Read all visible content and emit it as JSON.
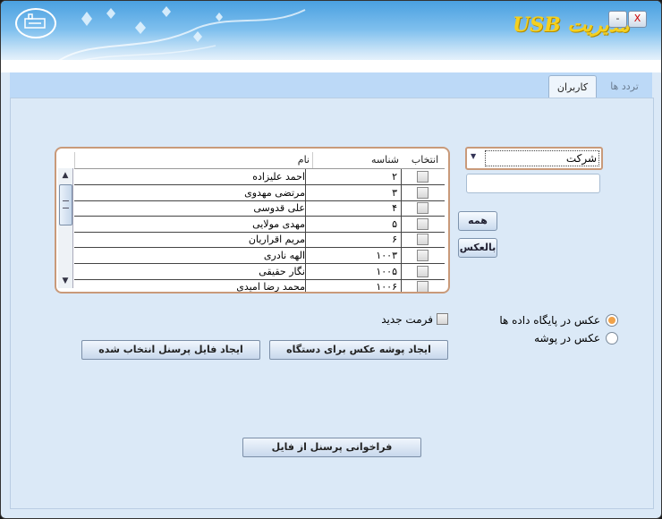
{
  "window": {
    "title": "مدیریت USB",
    "minimize_label": "-",
    "close_label": "X"
  },
  "tabs": [
    {
      "label": "کاربران",
      "active": true
    },
    {
      "label": "تردد ها",
      "active": false
    }
  ],
  "company_combo": {
    "value": "شرکت"
  },
  "search_box": {
    "value": ""
  },
  "buttons": {
    "all": "همه",
    "invert": "بالعکس",
    "create_selected_file": "ایجاد فایل پرسنل انتخاب شده",
    "create_photo_folder": "ایجاد پوشه عکس برای دستگاه",
    "import_from_file": "فراخوانی پرسنل از فایل"
  },
  "grid": {
    "headers": {
      "select": "انتخاب",
      "id": "شناسه",
      "name": "نام"
    },
    "rows": [
      {
        "id": "۲",
        "name": "احمد علیزاده",
        "checked": false
      },
      {
        "id": "۳",
        "name": "مرتضی مهدوی",
        "checked": false
      },
      {
        "id": "۴",
        "name": "علی قدوسی",
        "checked": false
      },
      {
        "id": "۵",
        "name": "مهدی مولایی",
        "checked": false
      },
      {
        "id": "۶",
        "name": "مریم اقراریان",
        "checked": false
      },
      {
        "id": "۱۰۰۳",
        "name": "الهه نادری",
        "checked": false
      },
      {
        "id": "۱۰۰۵",
        "name": "نگار حقیقی",
        "checked": false
      },
      {
        "id": "۱۰۰۶",
        "name": "محمد رضا امیدی",
        "checked": false
      }
    ]
  },
  "options": {
    "new_format": "فرمت جدید",
    "photo_in_db": "عکس در پایگاه داده ها",
    "photo_in_folder": "عکس در پوشه",
    "selected_photo_option": "photo_in_db"
  },
  "colors": {
    "accent_radio": "#f0a24a",
    "title_text": "#f5d020",
    "panel_bg": "#dbe9f7"
  }
}
